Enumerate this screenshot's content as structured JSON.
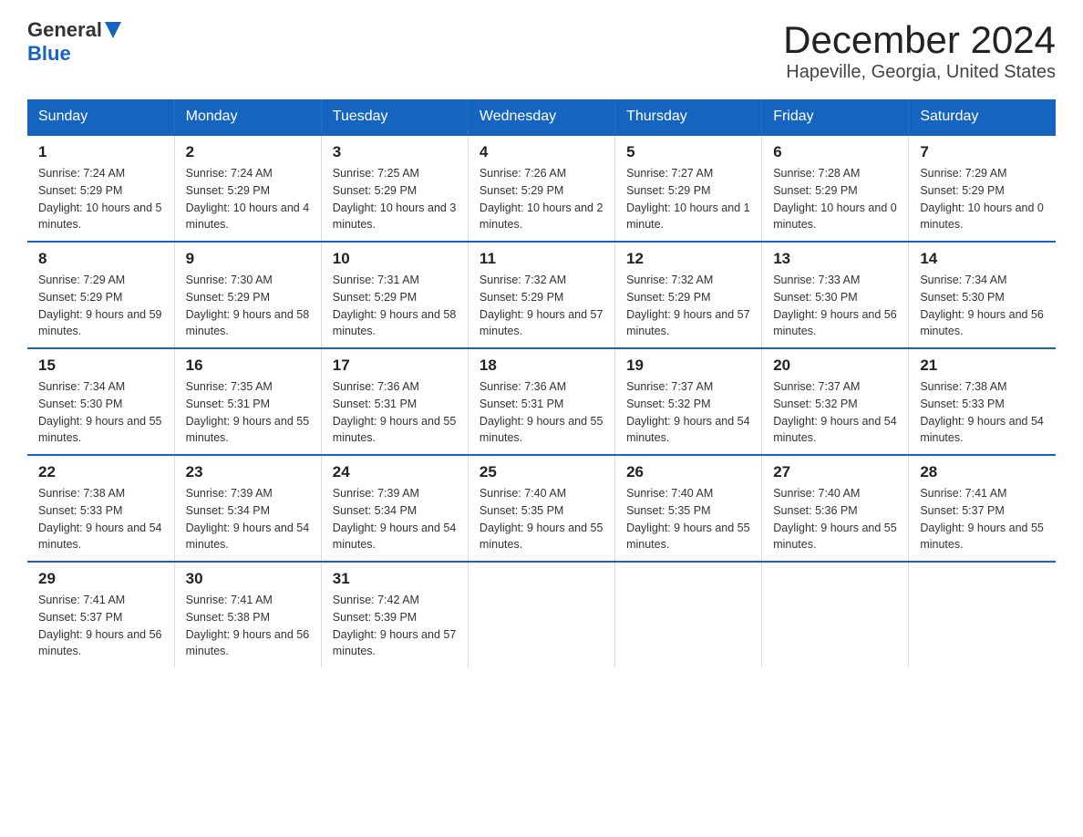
{
  "logo": {
    "general": "General",
    "blue": "Blue"
  },
  "title": "December 2024",
  "subtitle": "Hapeville, Georgia, United States",
  "days_of_week": [
    "Sunday",
    "Monday",
    "Tuesday",
    "Wednesday",
    "Thursday",
    "Friday",
    "Saturday"
  ],
  "weeks": [
    [
      {
        "day": "1",
        "sunrise": "7:24 AM",
        "sunset": "5:29 PM",
        "daylight": "10 hours and 5 minutes."
      },
      {
        "day": "2",
        "sunrise": "7:24 AM",
        "sunset": "5:29 PM",
        "daylight": "10 hours and 4 minutes."
      },
      {
        "day": "3",
        "sunrise": "7:25 AM",
        "sunset": "5:29 PM",
        "daylight": "10 hours and 3 minutes."
      },
      {
        "day": "4",
        "sunrise": "7:26 AM",
        "sunset": "5:29 PM",
        "daylight": "10 hours and 2 minutes."
      },
      {
        "day": "5",
        "sunrise": "7:27 AM",
        "sunset": "5:29 PM",
        "daylight": "10 hours and 1 minute."
      },
      {
        "day": "6",
        "sunrise": "7:28 AM",
        "sunset": "5:29 PM",
        "daylight": "10 hours and 0 minutes."
      },
      {
        "day": "7",
        "sunrise": "7:29 AM",
        "sunset": "5:29 PM",
        "daylight": "10 hours and 0 minutes."
      }
    ],
    [
      {
        "day": "8",
        "sunrise": "7:29 AM",
        "sunset": "5:29 PM",
        "daylight": "9 hours and 59 minutes."
      },
      {
        "day": "9",
        "sunrise": "7:30 AM",
        "sunset": "5:29 PM",
        "daylight": "9 hours and 58 minutes."
      },
      {
        "day": "10",
        "sunrise": "7:31 AM",
        "sunset": "5:29 PM",
        "daylight": "9 hours and 58 minutes."
      },
      {
        "day": "11",
        "sunrise": "7:32 AM",
        "sunset": "5:29 PM",
        "daylight": "9 hours and 57 minutes."
      },
      {
        "day": "12",
        "sunrise": "7:32 AM",
        "sunset": "5:29 PM",
        "daylight": "9 hours and 57 minutes."
      },
      {
        "day": "13",
        "sunrise": "7:33 AM",
        "sunset": "5:30 PM",
        "daylight": "9 hours and 56 minutes."
      },
      {
        "day": "14",
        "sunrise": "7:34 AM",
        "sunset": "5:30 PM",
        "daylight": "9 hours and 56 minutes."
      }
    ],
    [
      {
        "day": "15",
        "sunrise": "7:34 AM",
        "sunset": "5:30 PM",
        "daylight": "9 hours and 55 minutes."
      },
      {
        "day": "16",
        "sunrise": "7:35 AM",
        "sunset": "5:31 PM",
        "daylight": "9 hours and 55 minutes."
      },
      {
        "day": "17",
        "sunrise": "7:36 AM",
        "sunset": "5:31 PM",
        "daylight": "9 hours and 55 minutes."
      },
      {
        "day": "18",
        "sunrise": "7:36 AM",
        "sunset": "5:31 PM",
        "daylight": "9 hours and 55 minutes."
      },
      {
        "day": "19",
        "sunrise": "7:37 AM",
        "sunset": "5:32 PM",
        "daylight": "9 hours and 54 minutes."
      },
      {
        "day": "20",
        "sunrise": "7:37 AM",
        "sunset": "5:32 PM",
        "daylight": "9 hours and 54 minutes."
      },
      {
        "day": "21",
        "sunrise": "7:38 AM",
        "sunset": "5:33 PM",
        "daylight": "9 hours and 54 minutes."
      }
    ],
    [
      {
        "day": "22",
        "sunrise": "7:38 AM",
        "sunset": "5:33 PM",
        "daylight": "9 hours and 54 minutes."
      },
      {
        "day": "23",
        "sunrise": "7:39 AM",
        "sunset": "5:34 PM",
        "daylight": "9 hours and 54 minutes."
      },
      {
        "day": "24",
        "sunrise": "7:39 AM",
        "sunset": "5:34 PM",
        "daylight": "9 hours and 54 minutes."
      },
      {
        "day": "25",
        "sunrise": "7:40 AM",
        "sunset": "5:35 PM",
        "daylight": "9 hours and 55 minutes."
      },
      {
        "day": "26",
        "sunrise": "7:40 AM",
        "sunset": "5:35 PM",
        "daylight": "9 hours and 55 minutes."
      },
      {
        "day": "27",
        "sunrise": "7:40 AM",
        "sunset": "5:36 PM",
        "daylight": "9 hours and 55 minutes."
      },
      {
        "day": "28",
        "sunrise": "7:41 AM",
        "sunset": "5:37 PM",
        "daylight": "9 hours and 55 minutes."
      }
    ],
    [
      {
        "day": "29",
        "sunrise": "7:41 AM",
        "sunset": "5:37 PM",
        "daylight": "9 hours and 56 minutes."
      },
      {
        "day": "30",
        "sunrise": "7:41 AM",
        "sunset": "5:38 PM",
        "daylight": "9 hours and 56 minutes."
      },
      {
        "day": "31",
        "sunrise": "7:42 AM",
        "sunset": "5:39 PM",
        "daylight": "9 hours and 57 minutes."
      },
      {
        "day": "",
        "sunrise": "",
        "sunset": "",
        "daylight": ""
      },
      {
        "day": "",
        "sunrise": "",
        "sunset": "",
        "daylight": ""
      },
      {
        "day": "",
        "sunrise": "",
        "sunset": "",
        "daylight": ""
      },
      {
        "day": "",
        "sunrise": "",
        "sunset": "",
        "daylight": ""
      }
    ]
  ]
}
